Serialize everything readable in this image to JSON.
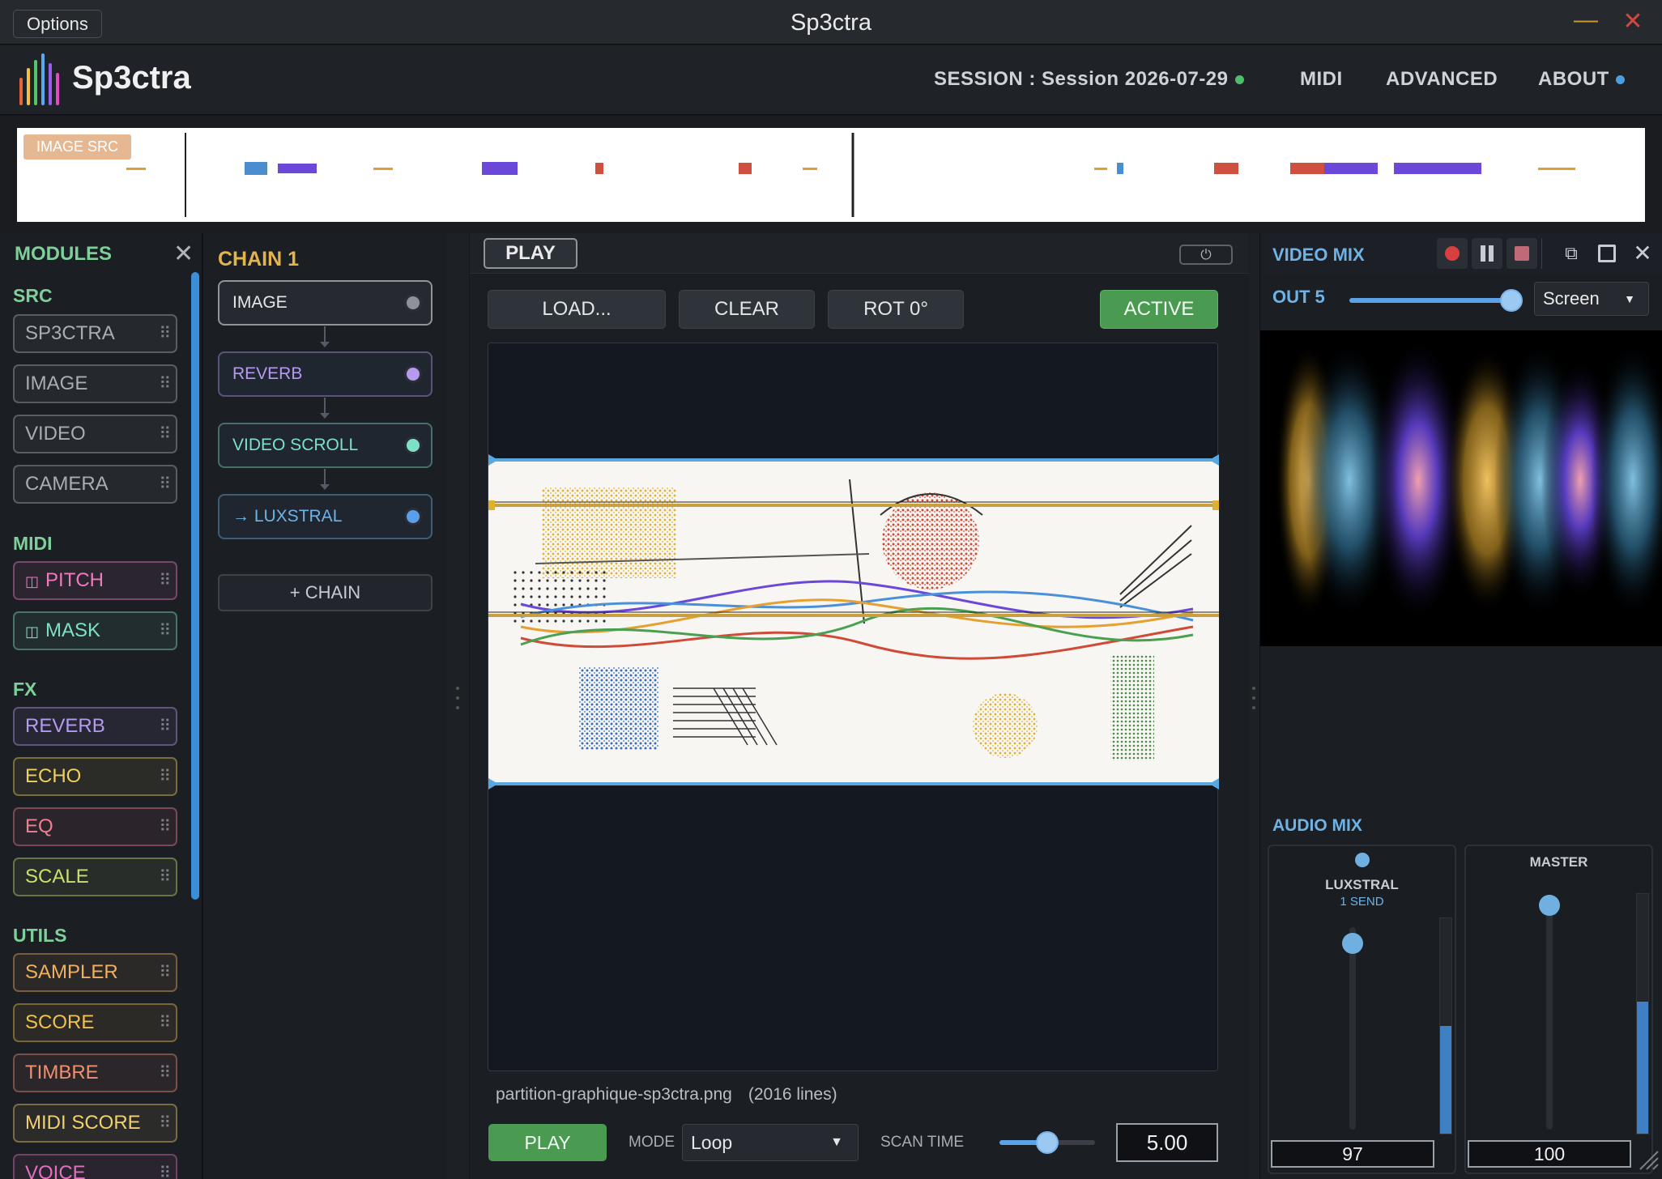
{
  "window": {
    "options_label": "Options",
    "title": "Sp3ctra",
    "minimize_glyph": "—",
    "close_glyph": "✕"
  },
  "header": {
    "app_name": "Sp3ctra",
    "session_label": "SESSION : Session 2026-07-29",
    "nav": [
      "MIDI",
      "ADVANCED",
      "ABOUT"
    ],
    "logo_colors": [
      "#e8653a",
      "#f0c040",
      "#55c46a",
      "#5aa8f0",
      "#9a5ef0",
      "#e04ac0"
    ]
  },
  "overview": {
    "badge": "IMAGE SRC"
  },
  "modules": {
    "title": "MODULES",
    "close_glyph": "✕",
    "categories": [
      {
        "label": "SRC",
        "items": [
          {
            "label": "SP3CTRA",
            "color": "#a8adb5"
          },
          {
            "label": "IMAGE",
            "color": "#a8adb5"
          },
          {
            "label": "VIDEO",
            "color": "#a8adb5"
          },
          {
            "label": "CAMERA",
            "color": "#a8adb5"
          }
        ]
      },
      {
        "label": "MIDI",
        "items": [
          {
            "label": "PITCH",
            "color": "#f07ac0",
            "icon": "piano-icon"
          },
          {
            "label": "MASK",
            "color": "#7fe0c8",
            "icon": "piano-icon"
          }
        ]
      },
      {
        "label": "FX",
        "items": [
          {
            "label": "REVERB",
            "color": "#b59af0"
          },
          {
            "label": "ECHO",
            "color": "#f0d060"
          },
          {
            "label": "EQ",
            "color": "#f08090"
          },
          {
            "label": "SCALE",
            "color": "#c8e070"
          }
        ]
      },
      {
        "label": "UTILS",
        "items": [
          {
            "label": "SAMPLER",
            "color": "#f0b060"
          },
          {
            "label": "SCORE",
            "color": "#f0c050"
          },
          {
            "label": "TIMBRE",
            "color": "#f09070"
          },
          {
            "label": "MIDI SCORE",
            "color": "#f0d070"
          },
          {
            "label": "VOICE",
            "color": "#e070c0"
          }
        ]
      }
    ]
  },
  "chain": {
    "title": "CHAIN 1",
    "nodes": [
      {
        "label": "IMAGE",
        "color": "#e6e8eb",
        "led": "#8d9199"
      },
      {
        "label": "REVERB",
        "color": "#b59af0",
        "led": "#b59af0"
      },
      {
        "label": "VIDEO SCROLL",
        "color": "#7fe0c8",
        "led": "#7fe0c8"
      },
      {
        "label": "→ LUXSTRAL",
        "color": "#6fb3e6",
        "led": "#5aa0e8"
      }
    ],
    "add_label": "+ CHAIN"
  },
  "main": {
    "play_top": "PLAY",
    "power_glyph": "⏻",
    "toolbar": {
      "load": "LOAD...",
      "clear": "CLEAR",
      "rot": "ROT 0°",
      "active": "ACTIVE"
    },
    "file_name": "partition-graphique-sp3ctra.png",
    "file_lines": "(2016 lines)",
    "play_bottom": "PLAY",
    "mode_label": "MODE",
    "mode_value": "Loop",
    "scan_label": "SCAN TIME",
    "scan_slider_fraction": 0.5,
    "scan_value": "5.00"
  },
  "video_mix": {
    "title": "VIDEO MIX",
    "out_label": "OUT 5",
    "out_slider_fraction": 1.0,
    "blend_mode": "Screen",
    "buttons": [
      "record-icon",
      "pause-icon",
      "stop-icon",
      "detach-icon",
      "fullscreen-icon",
      "close-icon"
    ]
  },
  "audio_mix": {
    "title": "AUDIO MIX",
    "strips": [
      {
        "name": "LUXSTRAL",
        "sub": "1 SEND",
        "value": "97",
        "level": 0.97,
        "meter": 0.5
      },
      {
        "name": "MASTER",
        "sub": "",
        "value": "100",
        "level": 1.0,
        "meter": 0.55
      }
    ]
  }
}
